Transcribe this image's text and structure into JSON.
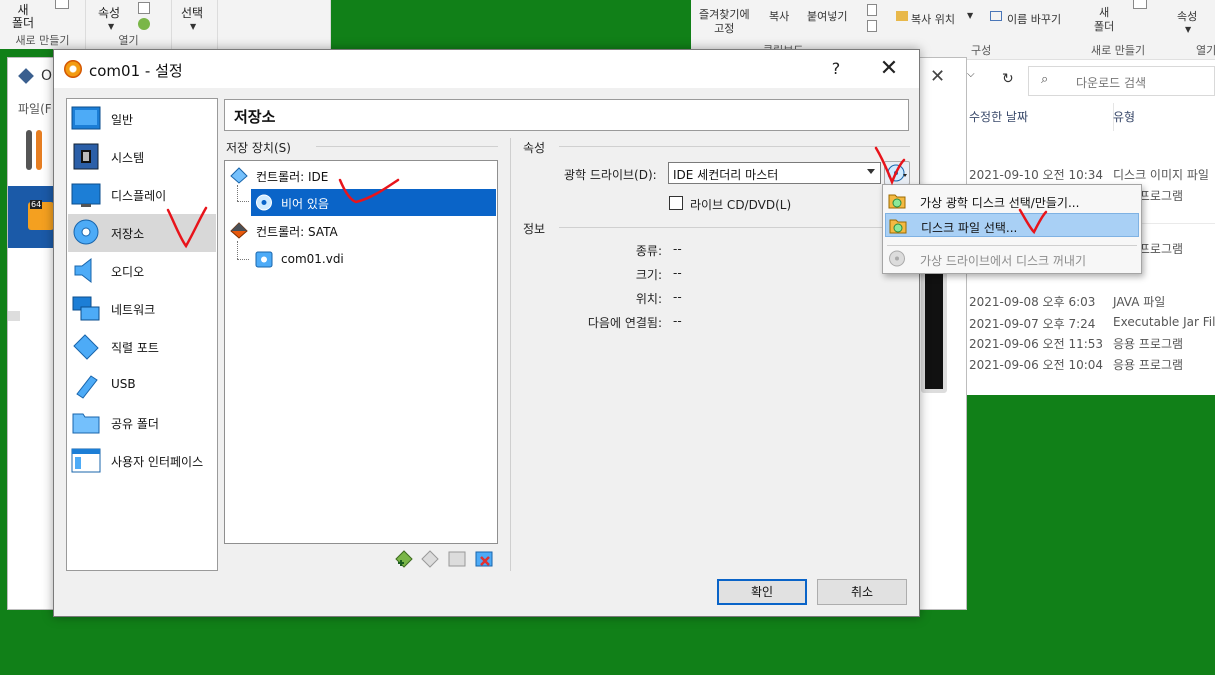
{
  "background_explorer_left": {
    "new_folder_label": "새\n폴더",
    "properties_label": "속성",
    "select_label": "선택",
    "group_new": "새로 만들기",
    "group_open": "열기"
  },
  "background_explorer_right": {
    "pin_label": "즐겨찾기에\n고정",
    "copy_label": "복사",
    "paste_label": "붙여넣기",
    "copy_to_label": "복사 위치",
    "rename_label": "이름 바꾸기",
    "new_folder_label": "새\n폴더",
    "properties_label": "속성",
    "group_clipboard": "클립보드",
    "group_organize": "구성",
    "group_new": "새로 만들기",
    "group_open": "열기",
    "search_placeholder": "다운로드 검색",
    "col_date": "수정한 날짜",
    "col_type": "유형",
    "files": [
      {
        "date": "2021-09-10 오전 10:34",
        "type": "디스크 이미지 파일"
      },
      {
        "date": "",
        "type": "응용 프로그램"
      },
      {
        "date": "",
        "type": "응용 프로그램"
      },
      {
        "date": "2021-09-08 오후 6:03",
        "type": "JAVA 파일"
      },
      {
        "date": "2021-09-07 오후 7:24",
        "type": "Executable Jar File"
      },
      {
        "date": "2021-09-06 오전 11:53",
        "type": "응용 프로그램"
      },
      {
        "date": "2021-09-06 오전 10:04",
        "type": "응용 프로그램"
      }
    ]
  },
  "vbox_main": {
    "title_fragment": "O",
    "menu_fragment": "파일(F"
  },
  "dialog": {
    "title": "com01 - 설정",
    "help": "?",
    "close": "✕",
    "section_title": "저장소",
    "sidebar": [
      {
        "label": "일반",
        "icon": "general-icon"
      },
      {
        "label": "시스템",
        "icon": "system-icon"
      },
      {
        "label": "디스플레이",
        "icon": "display-icon"
      },
      {
        "label": "저장소",
        "icon": "storage-icon",
        "active": true
      },
      {
        "label": "오디오",
        "icon": "audio-icon"
      },
      {
        "label": "네트워크",
        "icon": "network-icon"
      },
      {
        "label": "직렬 포트",
        "icon": "serial-port-icon"
      },
      {
        "label": "USB",
        "icon": "usb-icon"
      },
      {
        "label": "공유 폴더",
        "icon": "shared-folder-icon"
      },
      {
        "label": "사용자 인터페이스",
        "icon": "user-interface-icon"
      }
    ],
    "storage_devices_label": "저장 장치(S)",
    "tree": {
      "controller_ide": "컨트롤러: IDE",
      "ide_empty": "비어 있음",
      "controller_sata": "컨트롤러: SATA",
      "sata_disk": "com01.vdi"
    },
    "attributes_label": "속성",
    "optical_drive_label": "광학 드라이브(D):",
    "optical_drive_value": "IDE 세컨더리 마스터",
    "live_cd_label": "라이브 CD/DVD(L)",
    "info_label": "정보",
    "info": [
      {
        "key": "종류:",
        "value": "--"
      },
      {
        "key": "크기:",
        "value": "--"
      },
      {
        "key": "위치:",
        "value": "--"
      },
      {
        "key": "다음에 연결됨:",
        "value": "--"
      }
    ],
    "ok_label": "확인",
    "cancel_label": "취소"
  },
  "popup_menu": {
    "items": [
      {
        "label": "가상 광학 디스크 선택/만들기...",
        "icon": "folder-disc-icon"
      },
      {
        "label": "디스크 파일 선택...",
        "icon": "folder-disc-icon",
        "highlighted": true
      },
      {
        "label": "가상 드라이브에서 디스크 꺼내기",
        "icon": "eject-disc-icon",
        "disabled": true
      }
    ]
  },
  "colors": {
    "desktop": "#118018",
    "selection": "#0a64c8",
    "menu_highlight": "#a9d0f5",
    "annotation": "#e8141b"
  }
}
